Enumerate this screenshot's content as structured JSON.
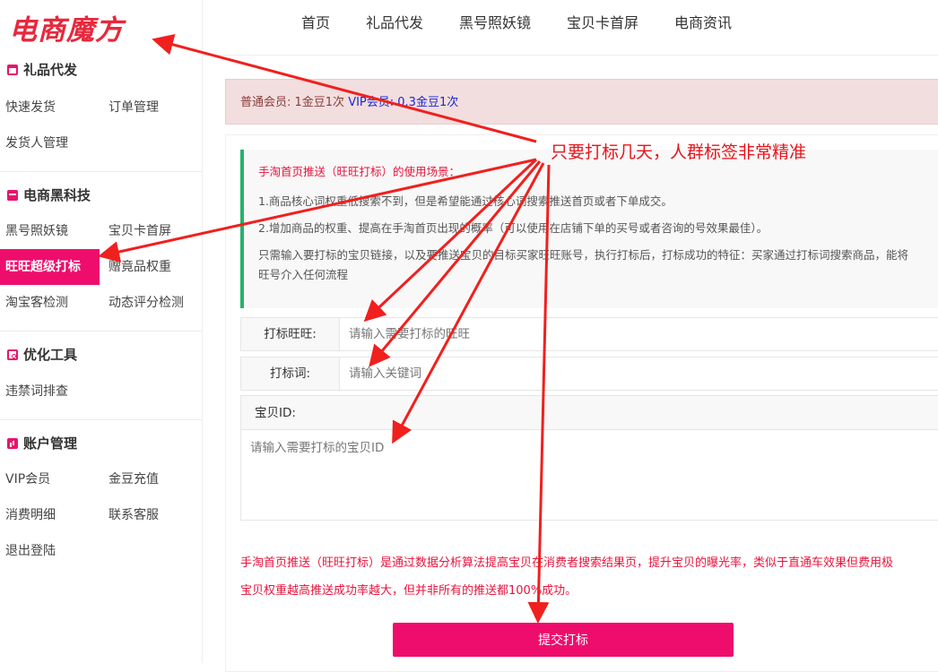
{
  "logo": "电商魔方",
  "sidebar": {
    "sections": [
      {
        "title": "礼品代发",
        "icon": "gift-icon",
        "items": [
          "快速发货",
          "订单管理",
          "发货人管理"
        ]
      },
      {
        "title": "电商黑科技",
        "icon": "tech-icon",
        "items": [
          "黑号照妖镜",
          "宝贝卡首屏",
          "旺旺超级打标",
          "赠竟品权重",
          "淘宝客检测",
          "动态评分检测"
        ]
      },
      {
        "title": "优化工具",
        "icon": "optimize-icon",
        "items": [
          "违禁词排查"
        ]
      },
      {
        "title": "账户管理",
        "icon": "account-icon",
        "items": [
          "VIP会员",
          "金豆充值",
          "消费明细",
          "联系客服",
          "退出登陆"
        ]
      }
    ],
    "active_item": "旺旺超级打标"
  },
  "topnav": [
    "首页",
    "礼品代发",
    "黑号照妖镜",
    "宝贝卡首屏",
    "电商资讯"
  ],
  "notice": {
    "normal": "普通会员: 1金豆1次",
    "vip": "VIP会员: 0.3金豆1次"
  },
  "info": {
    "title": "手淘首页推送（旺旺打标）的使用场景：",
    "p1": "1.商品核心词权重低搜索不到，但是希望能通过核心词搜索推送首页或者下单成交。",
    "p2": "2.增加商品的权重、提高在手淘首页出现的概率（可以使用在店铺下单的买号或者咨询的号效果最佳）。",
    "p3a": "只需输入要打标的宝贝链接，以及要推送宝贝的目标买家旺旺账号，执行打标后，打标成功的特征：买家通过打标词搜索商品，能将",
    "p3b": "旺号介入任何流程"
  },
  "form": {
    "wangwang_label": "打标旺旺:",
    "wangwang_placeholder": "请输入需要打标的旺旺",
    "keyword_label": "打标词:",
    "keyword_placeholder": "请输入关键词",
    "itemid_label": "宝贝ID:",
    "itemid_placeholder": "请输入需要打标的宝贝ID"
  },
  "desc": {
    "line1": "手淘首页推送（旺旺打标）是通过数据分析算法提高宝贝在消费者搜索结果页，提升宝贝的曝光率，类似于直通车效果但费用极",
    "line2": "宝贝权重越高推送成功率越大，但并非所有的推送都100%成功。"
  },
  "submit_label": "提交打标",
  "annotation": "只要打标几天，人群标签非常精准",
  "colors": {
    "accent": "#ee0d6c",
    "annotation": "#e8141c",
    "info_border": "#26b36c"
  }
}
